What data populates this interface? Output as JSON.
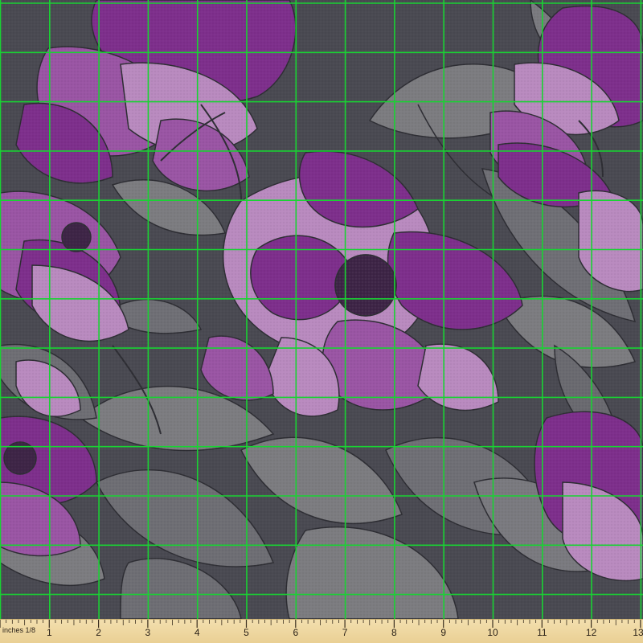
{
  "image": {
    "subject": "purple-peony-fabric-swatch",
    "colors": {
      "background": "#4a4a52",
      "leaf": "#7c7c80",
      "leaf_dark": "#616166",
      "petal_dark": "#7e2f8c",
      "petal_mid": "#9a55a4",
      "petal_light": "#b98abf",
      "outline": "#2e2e34",
      "grid_line": "#19d233"
    }
  },
  "ruler": {
    "unit_label": "inches 1/8",
    "numbers": [
      "1",
      "2",
      "3",
      "4",
      "5",
      "6",
      "7",
      "8",
      "9",
      "10",
      "11",
      "12",
      "13"
    ]
  }
}
